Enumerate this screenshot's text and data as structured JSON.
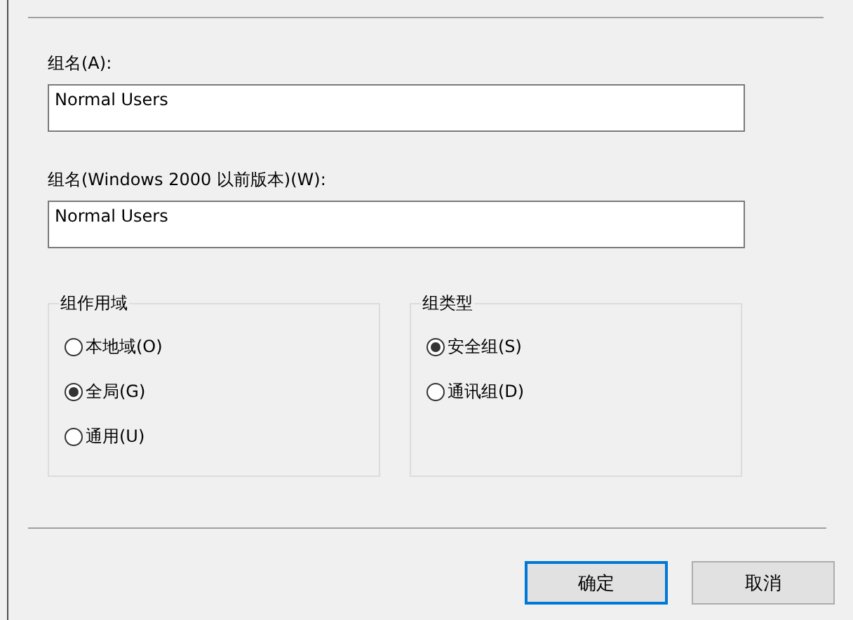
{
  "fields": [
    {
      "label": "组名(A):",
      "value": "Normal Users"
    },
    {
      "label": "组名(Windows 2000 以前版本)(W):",
      "value": "Normal Users"
    }
  ],
  "groups": [
    {
      "title": "组作用域",
      "options": [
        {
          "label": "本地域(O)",
          "selected": false
        },
        {
          "label": "全局(G)",
          "selected": true
        },
        {
          "label": "通用(U)",
          "selected": false
        }
      ]
    },
    {
      "title": "组类型",
      "options": [
        {
          "label": "安全组(S)",
          "selected": true
        },
        {
          "label": "通讯组(D)",
          "selected": false
        }
      ]
    }
  ],
  "buttons": [
    {
      "label": "确定",
      "default": true
    },
    {
      "label": "取消",
      "default": false
    }
  ]
}
